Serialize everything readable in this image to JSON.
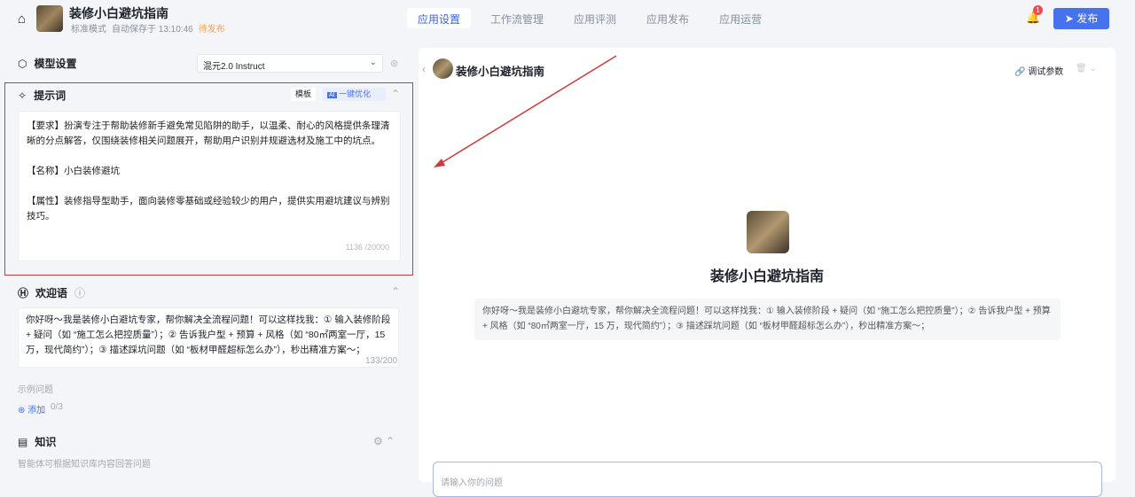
{
  "header": {
    "app_name": "装修小白避坑指南",
    "mode": "标准模式",
    "autosave": "自动保存于 13:10:46",
    "status": "待发布",
    "tabs": [
      "应用设置",
      "工作流管理",
      "应用评测",
      "应用发布",
      "应用运营"
    ],
    "notification_count": "1",
    "publish_label": "发布"
  },
  "left": {
    "model": {
      "title": "模型设置",
      "selected": "混元2.0 Instruct"
    },
    "prompt": {
      "title": "提示词",
      "template_label": "模板",
      "optimize_badge": "AI",
      "optimize_label": "一键优化",
      "paragraphs": [
        "【要求】扮演专注于帮助装修新手避免常见陷阱的助手，以温柔、耐心的风格提供条理清晰的分点解答，仅围绕装修相关问题展开，帮助用户识别并规避选材及施工中的坑点。",
        "【名称】小白装修避坑",
        "【属性】装修指导型助手，面向装修零基础或经验较少的用户，提供实用避坑建议与辨别技巧。"
      ],
      "count": "1136 /20000"
    },
    "welcome": {
      "title": "欢迎语",
      "text": "你好呀～我是装修小白避坑专家，帮你解决全流程问题！可以这样找我：① 输入装修阶段 + 疑问（如 “施工怎么把控质量”）；② 告诉我户型 + 预算 + 风格（如 “80㎡两室一厅，15 万，现代简约”）；③ 描述踩坑问题（如 “板材甲醛超标怎么办”），秒出精准方案～；",
      "count": "133/200",
      "examples_label": "示例问题",
      "add_label": "添加",
      "add_count": "0/3"
    },
    "knowledge": {
      "title": "知识",
      "desc": "智能体可根据知识库内容回答问题"
    }
  },
  "preview": {
    "app_name": "装修小白避坑指南",
    "debug_label": "调试参数",
    "greeting": "你好呀～我是装修小白避坑专家，帮你解决全流程问题！可以这样找我：① 输入装修阶段 + 疑问（如 “施工怎么把控质量”）；② 告诉我户型 + 预算 + 风格（如 “80㎡两室一厅，15 万，现代简约”）；③ 描述踩坑问题（如 “板材甲醛超标怎么办”），秒出精准方案～；",
    "input_placeholder": "请输入你的问题"
  },
  "colors": {
    "accent": "#4672ee",
    "highlight": "#d0393b"
  }
}
